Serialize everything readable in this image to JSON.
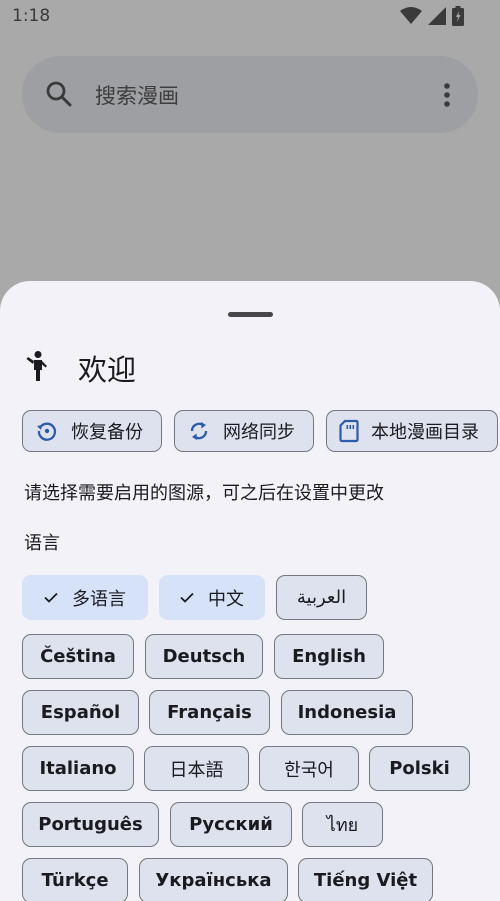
{
  "status_bar": {
    "time": "1:18",
    "icons": [
      "wifi-icon",
      "cell-signal-icon",
      "battery-icon"
    ]
  },
  "search": {
    "placeholder": "搜索漫画",
    "icon": "search-icon",
    "menu_icon": "more-vert-icon"
  },
  "sheet": {
    "welcome_icon": "person-walking-icon",
    "title": "欢迎",
    "actions": [
      {
        "label": "恢复备份",
        "icon": "restore-icon"
      },
      {
        "label": "网络同步",
        "icon": "sync-icon"
      },
      {
        "label": "本地漫画目录",
        "icon": "sd-card-icon"
      }
    ],
    "hint": "请选择需要启用的图源，可之后在设置中更改",
    "language_label": "语言",
    "languages": [
      {
        "label": "多语言",
        "selected": true
      },
      {
        "label": "中文",
        "selected": true
      },
      {
        "label": "العربية",
        "selected": false
      },
      {
        "label": "Čeština",
        "selected": false
      },
      {
        "label": "Deutsch",
        "selected": false
      },
      {
        "label": "English",
        "selected": false
      },
      {
        "label": "Español",
        "selected": false
      },
      {
        "label": "Français",
        "selected": false
      },
      {
        "label": "Indonesia",
        "selected": false
      },
      {
        "label": "Italiano",
        "selected": false
      },
      {
        "label": "日本語",
        "selected": false
      },
      {
        "label": "한국어",
        "selected": false
      },
      {
        "label": "Polski",
        "selected": false
      },
      {
        "label": "Português",
        "selected": false
      },
      {
        "label": "Русский",
        "selected": false
      },
      {
        "label": "ไทย",
        "selected": false
      },
      {
        "label": "Türkçe",
        "selected": false
      },
      {
        "label": "Українська",
        "selected": false
      },
      {
        "label": "Tiếng Việt",
        "selected": false
      }
    ]
  }
}
